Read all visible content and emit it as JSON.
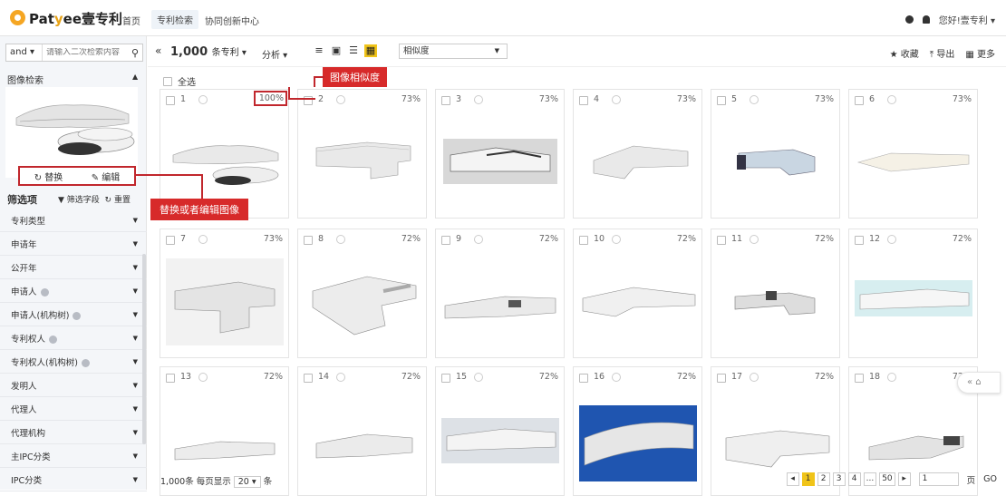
{
  "brand": {
    "logo_a": "Pat",
    "logo_b": "ee",
    "logo_c": "壹专利"
  },
  "nav": {
    "home": "首页",
    "patent_search": "专利检索",
    "collab": "协同创新中心"
  },
  "user": {
    "greeting": "您好!壹专利 ▾"
  },
  "sidebar": {
    "logic_select": "and ▾",
    "search_placeholder": "请输入二次检索内容",
    "image_search_title": "图像检索",
    "replace_label": "替换",
    "edit_label": "编辑",
    "filter_title": "筛选项",
    "filter_fields_label": "筛选字段",
    "reset_label": "重置",
    "filters": [
      {
        "label": "专利类型",
        "help": false
      },
      {
        "label": "申请年",
        "help": false
      },
      {
        "label": "公开年",
        "help": false
      },
      {
        "label": "申请人",
        "help": true
      },
      {
        "label": "申请人(机构树)",
        "help": true
      },
      {
        "label": "专利权人",
        "help": true
      },
      {
        "label": "专利权人(机构树)",
        "help": true
      },
      {
        "label": "发明人",
        "help": false
      },
      {
        "label": "代理人",
        "help": false
      },
      {
        "label": "代理机构",
        "help": false
      },
      {
        "label": "主IPC分类",
        "help": false
      },
      {
        "label": "IPC分类",
        "help": false
      }
    ]
  },
  "toolbar": {
    "back": "«",
    "count": "1,000",
    "count_unit": "条专利 ▾",
    "analyze": "分析 ▾",
    "sort": "相似度",
    "favorite": "★ 收藏",
    "export": "⤒ 导出",
    "more": "▦ 更多"
  },
  "results": {
    "select_all": "全选",
    "cards": [
      {
        "num": "1",
        "pct": "100%"
      },
      {
        "num": "2",
        "pct": "73%"
      },
      {
        "num": "3",
        "pct": "73%"
      },
      {
        "num": "4",
        "pct": "73%"
      },
      {
        "num": "5",
        "pct": "73%"
      },
      {
        "num": "6",
        "pct": "73%"
      },
      {
        "num": "7",
        "pct": "73%"
      },
      {
        "num": "8",
        "pct": "72%"
      },
      {
        "num": "9",
        "pct": "72%"
      },
      {
        "num": "10",
        "pct": "72%"
      },
      {
        "num": "11",
        "pct": "72%"
      },
      {
        "num": "12",
        "pct": "72%"
      },
      {
        "num": "13",
        "pct": "72%"
      },
      {
        "num": "14",
        "pct": "72%"
      },
      {
        "num": "15",
        "pct": "72%"
      },
      {
        "num": "16",
        "pct": "72%"
      },
      {
        "num": "17",
        "pct": "72%"
      },
      {
        "num": "18",
        "pct": "72%"
      }
    ]
  },
  "annotations": {
    "similarity": "图像相似度",
    "replace_edit": "替换或者编辑图像"
  },
  "pager": {
    "total": "1,000条 每页显示",
    "page_size": "20 ▾",
    "unit": "条",
    "prev": "◂",
    "pages": [
      "1",
      "2",
      "3",
      "4",
      "...",
      "50"
    ],
    "next": "▸",
    "goto_value": "1",
    "page_word": "页",
    "go": "GO"
  },
  "float": {
    "label": "« ⌂"
  },
  "colors": {
    "accent": "#f0c419",
    "annotation": "#d72a2a",
    "sidebar_bg": "#f4f6f9"
  }
}
